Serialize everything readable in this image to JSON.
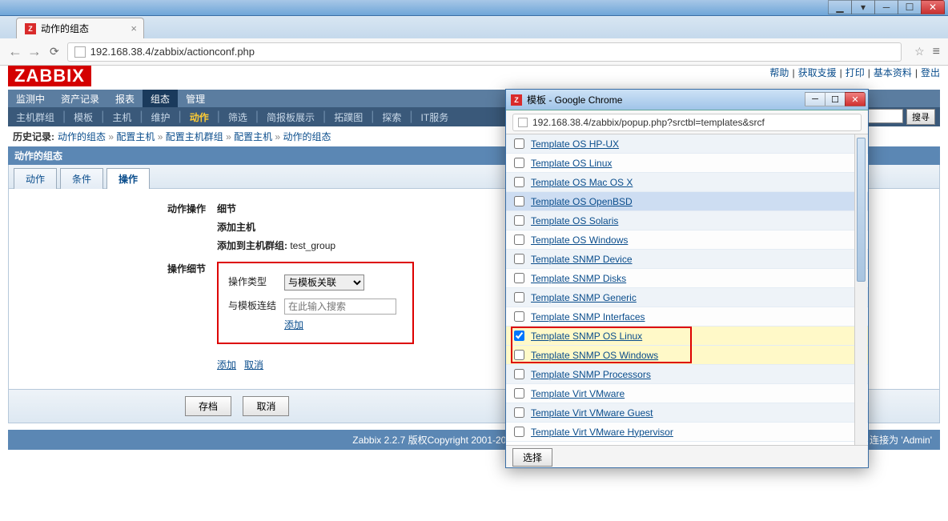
{
  "window": {
    "title": "动作的组态"
  },
  "browser": {
    "tab_title": "动作的组态",
    "url": "192.168.38.4/zabbix/actionconf.php"
  },
  "logo": "ZABBIX",
  "top_links": [
    "帮助",
    "获取支援",
    "打印",
    "基本资料",
    "登出"
  ],
  "menu": {
    "items": [
      "监测中",
      "资产记录",
      "报表",
      "组态",
      "管理"
    ],
    "active": 3
  },
  "submenu": {
    "items": [
      "主机群组",
      "模板",
      "主机",
      "维护",
      "动作",
      "筛选",
      "简报板展示",
      "拓蹼图",
      "探索",
      "IT服务"
    ],
    "active": 4,
    "search_btn": "搜寻"
  },
  "history": {
    "label": "历史记录:",
    "crumbs": [
      "动作的组态",
      "配置主机",
      "配置主机群组",
      "配置主机",
      "动作的组态"
    ]
  },
  "section": "动作的组态",
  "ztabs": {
    "items": [
      "动作",
      "条件",
      "操作"
    ],
    "active": 2
  },
  "form": {
    "row1_label": "动作操作",
    "row1_val": "细节",
    "row1_v2": "添加主机",
    "row1_v3_label": "添加到主机群组:",
    "row1_v3_val": "test_group",
    "row2_label": "操作细节",
    "op_type_label": "操作类型",
    "op_type_value": "与模板关联",
    "link_label": "与模板连结",
    "link_placeholder": "在此输入搜索",
    "add_link": "添加",
    "bottom_add": "添加",
    "bottom_cancel": "取消"
  },
  "buttons": {
    "save": "存档",
    "cancel": "取消"
  },
  "footer": {
    "center": "Zabbix 2.2.7 版权Copyright 2001-2014 由Zabbix SIA拥有",
    "right": "连接为 'Admin'"
  },
  "popup": {
    "title": "模板 - Google Chrome",
    "url": "192.168.38.4/zabbix/popup.php?srctbl=templates&srcf",
    "items": [
      {
        "label": "Template OS HP-UX"
      },
      {
        "label": "Template OS Linux"
      },
      {
        "label": "Template OS Mac OS X"
      },
      {
        "label": "Template OS OpenBSD",
        "selected_look": true
      },
      {
        "label": "Template OS Solaris"
      },
      {
        "label": "Template OS Windows"
      },
      {
        "label": "Template SNMP Device"
      },
      {
        "label": "Template SNMP Disks"
      },
      {
        "label": "Template SNMP Generic"
      },
      {
        "label": "Template SNMP Interfaces"
      },
      {
        "label": "Template SNMP OS Linux",
        "checked": true,
        "hl": true
      },
      {
        "label": "Template SNMP OS Windows",
        "hl": true
      },
      {
        "label": "Template SNMP Processors"
      },
      {
        "label": "Template Virt VMware"
      },
      {
        "label": "Template Virt VMware Guest"
      },
      {
        "label": "Template Virt VMware Hypervisor"
      }
    ],
    "select_btn": "选择"
  }
}
